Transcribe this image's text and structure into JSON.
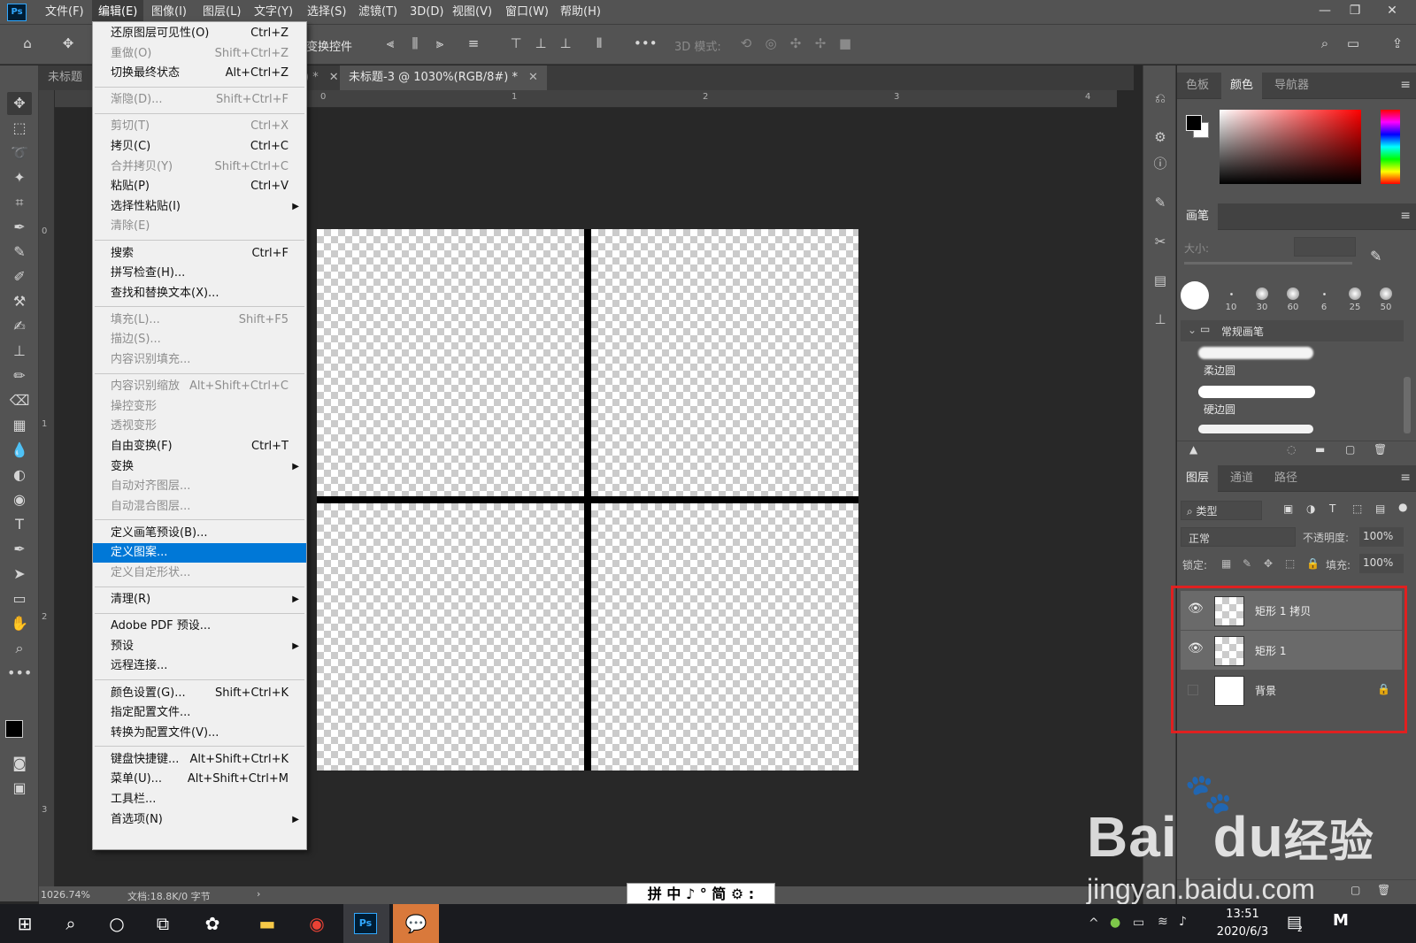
{
  "app": {
    "logo": "Ps"
  },
  "menubar": {
    "items": [
      "文件(F)",
      "编辑(E)",
      "图像(I)",
      "图层(L)",
      "文字(Y)",
      "选择(S)",
      "滤镜(T)",
      "3D(D)",
      "视图(V)",
      "窗口(W)",
      "帮助(H)"
    ],
    "active": "编辑(E)"
  },
  "options": {
    "transform_label": "变换控件",
    "mode_3d_label": "3D 模式:"
  },
  "tabs": [
    {
      "label": "未标题",
      "active": false
    },
    {
      "label": ") *",
      "active": false
    },
    {
      "label": "未标题-3 @ 1030%(RGB/8#) *",
      "active": true
    }
  ],
  "rulers": {
    "top": [
      "0",
      "1",
      "2",
      "3",
      "4"
    ],
    "left": [
      "0",
      "1",
      "2",
      "3"
    ]
  },
  "edit_menu": {
    "items": [
      {
        "label": "还原图层可见性(O)",
        "shortcut": "Ctrl+Z",
        "disabled": false
      },
      {
        "label": "重做(O)",
        "shortcut": "Shift+Ctrl+Z",
        "disabled": true
      },
      {
        "label": "切换最终状态",
        "shortcut": "Alt+Ctrl+Z",
        "disabled": false
      },
      {
        "label": "渐隐(D)...",
        "shortcut": "Shift+Ctrl+F",
        "disabled": true
      },
      {
        "label": "剪切(T)",
        "shortcut": "Ctrl+X",
        "disabled": true
      },
      {
        "label": "拷贝(C)",
        "shortcut": "Ctrl+C",
        "disabled": false
      },
      {
        "label": "合并拷贝(Y)",
        "shortcut": "Shift+Ctrl+C",
        "disabled": true
      },
      {
        "label": "粘贴(P)",
        "shortcut": "Ctrl+V",
        "disabled": false
      },
      {
        "label": "选择性粘贴(I)",
        "shortcut": "",
        "disabled": false,
        "submenu": true
      },
      {
        "label": "清除(E)",
        "shortcut": "",
        "disabled": true
      },
      {
        "label": "搜索",
        "shortcut": "Ctrl+F",
        "disabled": false
      },
      {
        "label": "拼写检查(H)...",
        "shortcut": "",
        "disabled": false
      },
      {
        "label": "查找和替换文本(X)...",
        "shortcut": "",
        "disabled": false
      },
      {
        "label": "填充(L)...",
        "shortcut": "Shift+F5",
        "disabled": true
      },
      {
        "label": "描边(S)...",
        "shortcut": "",
        "disabled": true
      },
      {
        "label": "内容识别填充...",
        "shortcut": "",
        "disabled": true
      },
      {
        "label": "内容识别缩放",
        "shortcut": "Alt+Shift+Ctrl+C",
        "disabled": true
      },
      {
        "label": "操控变形",
        "shortcut": "",
        "disabled": true
      },
      {
        "label": "透视变形",
        "shortcut": "",
        "disabled": true
      },
      {
        "label": "自由变换(F)",
        "shortcut": "Ctrl+T",
        "disabled": false
      },
      {
        "label": "变换",
        "shortcut": "",
        "disabled": false,
        "submenu": true
      },
      {
        "label": "自动对齐图层...",
        "shortcut": "",
        "disabled": true
      },
      {
        "label": "自动混合图层...",
        "shortcut": "",
        "disabled": true
      },
      {
        "label": "定义画笔预设(B)...",
        "shortcut": "",
        "disabled": false
      },
      {
        "label": "定义图案...",
        "shortcut": "",
        "disabled": false,
        "highlighted": true
      },
      {
        "label": "定义自定形状...",
        "shortcut": "",
        "disabled": true
      },
      {
        "label": "清理(R)",
        "shortcut": "",
        "disabled": false,
        "submenu": true
      },
      {
        "label": "Adobe PDF 预设...",
        "shortcut": "",
        "disabled": false
      },
      {
        "label": "预设",
        "shortcut": "",
        "disabled": false,
        "submenu": true
      },
      {
        "label": "远程连接...",
        "shortcut": "",
        "disabled": false
      },
      {
        "label": "颜色设置(G)...",
        "shortcut": "Shift+Ctrl+K",
        "disabled": false
      },
      {
        "label": "指定配置文件...",
        "shortcut": "",
        "disabled": false
      },
      {
        "label": "转换为配置文件(V)...",
        "shortcut": "",
        "disabled": false
      },
      {
        "label": "键盘快捷键...",
        "shortcut": "Alt+Shift+Ctrl+K",
        "disabled": false
      },
      {
        "label": "菜单(U)...",
        "shortcut": "Alt+Shift+Ctrl+M",
        "disabled": false
      },
      {
        "label": "工具栏...",
        "shortcut": "",
        "disabled": false
      },
      {
        "label": "首选项(N)",
        "shortcut": "",
        "disabled": false,
        "submenu": true
      }
    ]
  },
  "statusbar": {
    "zoom": "1026.74%",
    "doc": "文档:18.8K/0 字节"
  },
  "ime": {
    "text": "拼 中 ♪ ° 简 ⚙ :"
  },
  "color_panel": {
    "tabs": [
      "色板",
      "颜色",
      "导航器"
    ],
    "active": "颜色"
  },
  "brush_panel": {
    "title": "画笔",
    "size_label": "大小:",
    "presets": [
      "10",
      "30",
      "60",
      "6",
      "25",
      "50"
    ],
    "group": "常规画笔",
    "brushes": [
      "柔边圆",
      "硬边圆"
    ]
  },
  "layers_panel": {
    "tabs": [
      "图层",
      "通道",
      "路径"
    ],
    "active": "图层",
    "filter": "类型",
    "blend": "正常",
    "opacity_label": "不透明度:",
    "opacity": "100%",
    "lock_label": "锁定:",
    "fill_label": "填充:",
    "fill": "100%",
    "layers": [
      {
        "name": "矩形 1 拷贝",
        "visible": true
      },
      {
        "name": "矩形 1",
        "visible": true
      },
      {
        "name": "背景",
        "visible": false,
        "locked": true
      }
    ]
  },
  "taskbar": {
    "time": "13:51",
    "date": "2020/6/3",
    "notif": "2"
  },
  "watermark": {
    "brand": "Bai",
    "brand2": "du",
    "cn": "经验",
    "url": "jingyan.baidu.com"
  },
  "colors": {
    "accent": "#0078d7",
    "highlight_box": "#e02020",
    "ui_bg": "#535353"
  }
}
